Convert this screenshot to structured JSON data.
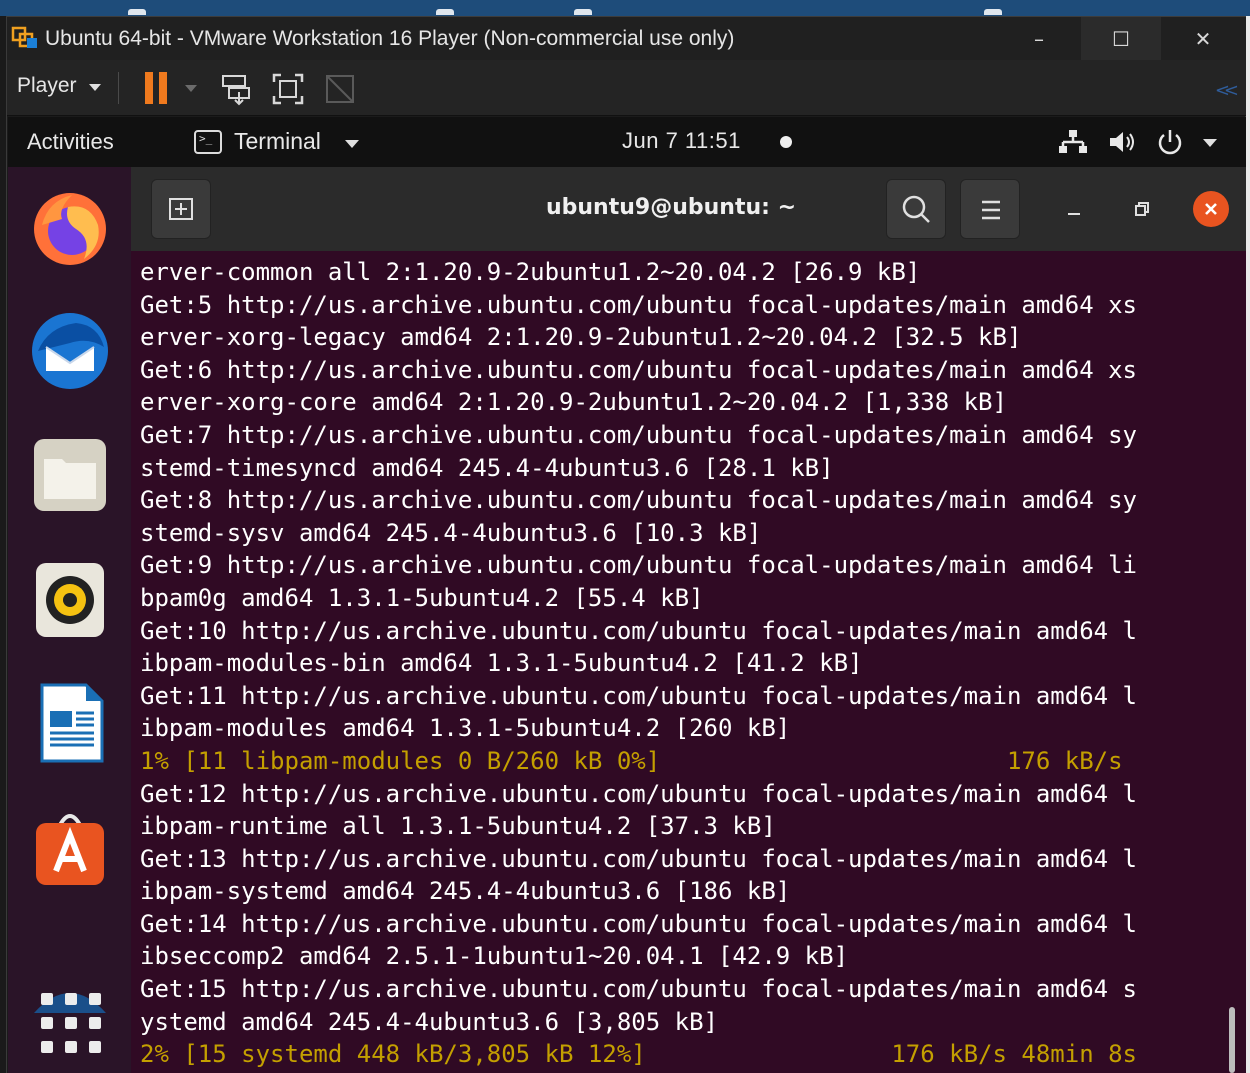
{
  "vmware": {
    "title": "Ubuntu 64-bit - VMware Workstation 16 Player (Non-commercial use only)",
    "player_menu": "Player",
    "minimize": "–",
    "maximize": "☐",
    "close": "✕"
  },
  "gnome": {
    "activities": "Activities",
    "app_menu": "Terminal",
    "clock": "Jun 7  11:51"
  },
  "terminal": {
    "title": "ubuntu9@ubuntu: ~",
    "lines": [
      "erver-common all 2:1.20.9-2ubuntu1.2~20.04.2 [26.9 kB]",
      "Get:5 http://us.archive.ubuntu.com/ubuntu focal-updates/main amd64 xs",
      "erver-xorg-legacy amd64 2:1.20.9-2ubuntu1.2~20.04.2 [32.5 kB]",
      "Get:6 http://us.archive.ubuntu.com/ubuntu focal-updates/main amd64 xs",
      "erver-xorg-core amd64 2:1.20.9-2ubuntu1.2~20.04.2 [1,338 kB]",
      "Get:7 http://us.archive.ubuntu.com/ubuntu focal-updates/main amd64 sy",
      "stemd-timesyncd amd64 245.4-4ubuntu3.6 [28.1 kB]",
      "Get:8 http://us.archive.ubuntu.com/ubuntu focal-updates/main amd64 sy",
      "stemd-sysv amd64 245.4-4ubuntu3.6 [10.3 kB]",
      "Get:9 http://us.archive.ubuntu.com/ubuntu focal-updates/main amd64 li",
      "bpam0g amd64 1.3.1-5ubuntu4.2 [55.4 kB]",
      "Get:10 http://us.archive.ubuntu.com/ubuntu focal-updates/main amd64 l",
      "ibpam-modules-bin amd64 1.3.1-5ubuntu4.2 [41.2 kB]",
      "Get:11 http://us.archive.ubuntu.com/ubuntu focal-updates/main amd64 l",
      "ibpam-modules amd64 1.3.1-5ubuntu4.2 [260 kB]",
      "1% [11 libpam-modules 0 B/260 kB 0%]                        176 kB/s",
      "Get:12 http://us.archive.ubuntu.com/ubuntu focal-updates/main amd64 l",
      "ibpam-runtime all 1.3.1-5ubuntu4.2 [37.3 kB]",
      "Get:13 http://us.archive.ubuntu.com/ubuntu focal-updates/main amd64 l",
      "ibpam-systemd amd64 245.4-4ubuntu3.6 [186 kB]",
      "Get:14 http://us.archive.ubuntu.com/ubuntu focal-updates/main amd64 l",
      "ibseccomp2 amd64 2.5.1-1ubuntu1~20.04.1 [42.9 kB]",
      "Get:15 http://us.archive.ubuntu.com/ubuntu focal-updates/main amd64 s",
      "ystemd amd64 245.4-4ubuntu3.6 [3,805 kB]",
      "2% [15 systemd 448 kB/3,805 kB 12%]                 176 kB/s 48min 8s"
    ]
  },
  "dock": {
    "apps": [
      "firefox-icon",
      "thunderbird-icon",
      "files-icon",
      "rhythmbox-icon",
      "libreoffice-writer-icon",
      "ubuntu-software-icon",
      "help-icon"
    ]
  },
  "colors": {
    "terminal_bg": "#300a24",
    "progress_text": "#c4a000",
    "accent_orange": "#e95420",
    "vmware_pause": "#f07a1e"
  }
}
